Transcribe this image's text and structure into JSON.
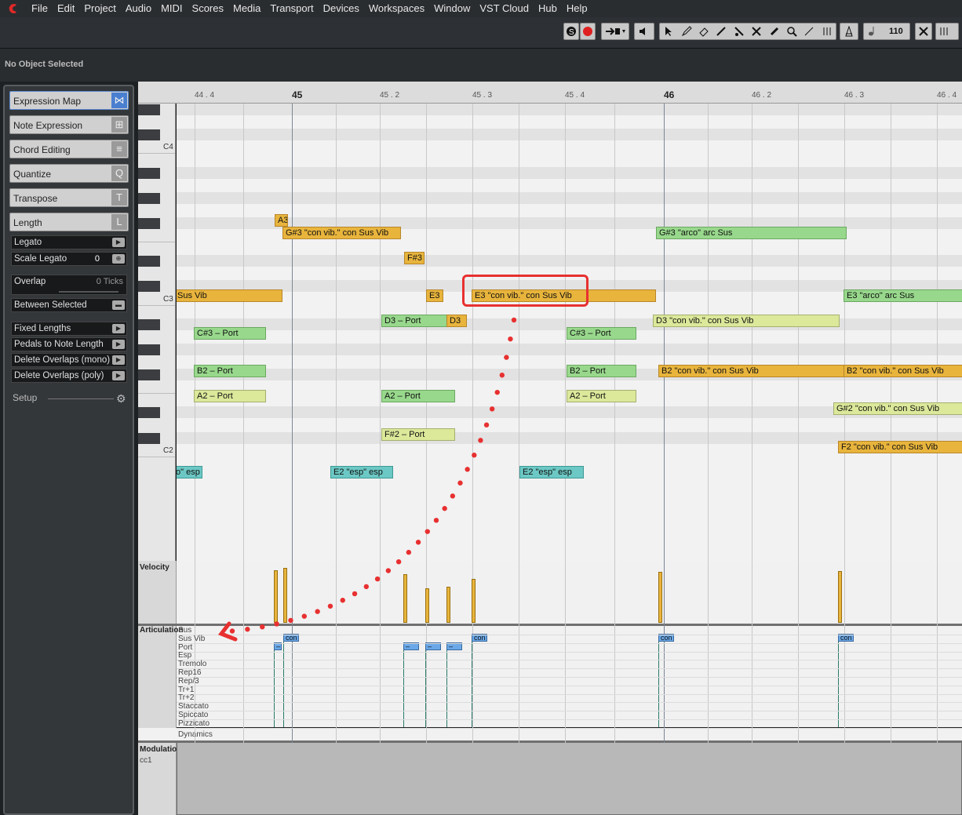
{
  "menu": [
    "File",
    "Edit",
    "Project",
    "Audio",
    "MIDI",
    "Scores",
    "Media",
    "Transport",
    "Devices",
    "Workspaces",
    "Window",
    "VST Cloud",
    "Hub",
    "Help"
  ],
  "toolbar": {
    "tempo_value": "110"
  },
  "infoline": {
    "status": "No Object Selected"
  },
  "inspector": {
    "sections": [
      "Expression Map",
      "Note Expression",
      "Chord Editing",
      "Quantize",
      "Transpose",
      "Length"
    ],
    "section_icons": [
      "⋈",
      "⊞",
      "≡",
      "Q",
      "T",
      "L"
    ],
    "rows": [
      {
        "label": "Legato"
      },
      {
        "label": "Scale Legato",
        "value": "0"
      },
      {
        "label": "Overlap",
        "value": "0 Ticks"
      },
      {
        "label": "Between Selected"
      }
    ],
    "actions": [
      "Fixed Lengths",
      "Pedals to Note Length",
      "Delete Overlaps (mono)",
      "Delete Overlaps (poly)"
    ],
    "setup_label": "Setup"
  },
  "ruler": {
    "ticks": [
      "44 . 4",
      "45",
      "45 . 2",
      "45 . 3",
      "45 . 4",
      "46",
      "46 . 2",
      "46 . 3",
      "46 . 4"
    ],
    "bar_ticks": [
      "45",
      "46"
    ]
  },
  "keyboard": {
    "labels": [
      "C4",
      "C3",
      "C2"
    ]
  },
  "notes": [
    {
      "text": "A3",
      "color": "orange"
    },
    {
      "text": "G#3 \"con vib.\" con Sus Vib",
      "color": "orange"
    },
    {
      "text": "G#3 \"arco\" arc Sus",
      "color": "green"
    },
    {
      "text": "F#3",
      "color": "orange"
    },
    {
      "text": "Sus Vib",
      "color": "orange"
    },
    {
      "text": "E3",
      "color": "orange"
    },
    {
      "text": "E3 \"con vib.\" con Sus Vib",
      "color": "orange"
    },
    {
      "text": "E3 \"arco\" arc Sus",
      "color": "green"
    },
    {
      "text": "D3 – Port",
      "color": "green"
    },
    {
      "text": "D3",
      "color": "orange"
    },
    {
      "text": "D3 \"con vib.\" con Sus Vib",
      "color": "ylw"
    },
    {
      "text": "C#3 – Port",
      "color": "green"
    },
    {
      "text": "C#3 – Port",
      "color": "green"
    },
    {
      "text": "B2 – Port",
      "color": "green"
    },
    {
      "text": "B2 – Port",
      "color": "green"
    },
    {
      "text": "B2 \"con vib.\" con Sus Vib",
      "color": "orange"
    },
    {
      "text": "B2 \"con vib.\" con Sus Vib",
      "color": "orange"
    },
    {
      "text": "A2 – Port",
      "color": "ylw"
    },
    {
      "text": "A2 – Port",
      "color": "green"
    },
    {
      "text": "A2 – Port",
      "color": "ylw"
    },
    {
      "text": "G#2 \"con vib.\" con Sus Vib",
      "color": "ylw"
    },
    {
      "text": "F#2 – Port",
      "color": "ylw"
    },
    {
      "text": "F2 \"con vib.\" con Sus Vib",
      "color": "orange"
    },
    {
      "text": "o\" esp",
      "color": "teal"
    },
    {
      "text": "E2 \"esp\" esp",
      "color": "teal"
    },
    {
      "text": "E2 \"esp\" esp",
      "color": "teal"
    }
  ],
  "lanes": {
    "velocity_title": "Velocity",
    "articulation_title": "Articulation",
    "articulations": [
      "Sus",
      "Sus Vib",
      "Port",
      "Esp",
      "Tremolo",
      "Rep16",
      "Rep/3",
      "Tr+1",
      "Tr+2",
      "Staccato",
      "Spiccato",
      "Pizzicato"
    ],
    "dynamics": "Dynamics",
    "art_tags": [
      "–",
      "con",
      "–",
      "–",
      "–",
      "con",
      "con",
      "con"
    ],
    "velocities": [
      100,
      105,
      92,
      65,
      68,
      83,
      97,
      98
    ],
    "modulation_title": "Modulation",
    "modulation_cc": "cc1"
  }
}
